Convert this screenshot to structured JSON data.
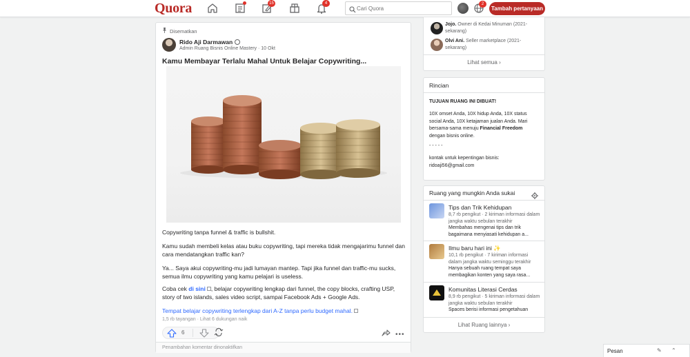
{
  "header": {
    "logo": "Quora",
    "notifications_badges": {
      "answer": "15",
      "notifications": "4",
      "language": "2"
    },
    "search_placeholder": "Cari Quora",
    "add_question": "Tambah pertanyaan"
  },
  "post": {
    "pinned_label": "Disematkan",
    "author": "Rido Aji Darmawan",
    "author_meta": "Admin Ruang Bisnis Online Mastery · 10 Okt",
    "title": "Kamu Membayar Terlalu Mahal Untuk Belajar Copywriting...",
    "p1": "Copywriting tanpa funnel & traffic is bullshit.",
    "p2": "Kamu sudah membeli kelas atau buku copywriting, tapi mereka tidak mengajarimu funnel dan cara mendatangkan traffic kan?",
    "p3": "Ya... Saya akui copywriting-mu jadi lumayan mantep. Tapi jika funnel dan traffic-mu sucks, semua ilmu copywriting yang kamu pelajari is useless.",
    "p4_pre": "Coba cek ",
    "p4_link": "di sini",
    "p4_post": ", belajar copywriting lengkap dari funnel, the copy blocks, crafting USP, story of two islands, sales video script, sampai Facebook Ads + Google Ads.",
    "link_text": "Tempat belajar copywriting terlengkap dari A-Z tanpa perlu budget mahal.",
    "stats": "1,5 rb tayangan · Lihat 6 dukungan naik",
    "upvotes": "6",
    "comments_disabled": "Penambahan komentar dinonaktifkan"
  },
  "members": {
    "items": [
      {
        "name": "Jojo.",
        "desc": " Owner di Kedai Minuman (2021-sekarang)"
      },
      {
        "name": "Olvi Ani.",
        "desc": " Seller marketplace (2021-sekarang)"
      }
    ],
    "see_all": "Lihat semua"
  },
  "details": {
    "heading": "Rincian",
    "purpose": "TUJUAN RUANG INI DIBUAT!",
    "body_pre": "10X omset Anda, 10X hidup Anda, 10X status social Anda, 10X ketajaman jualan Anda. Mari bersama-sama menuju ",
    "body_bold": "Financial Freedom",
    "body_post": " dengan bisnis online.",
    "dashes": "- - - - -",
    "contact": "kontak untuk kepentingan bisnis: ridoaji56@gmail.com"
  },
  "spaces": {
    "heading": "Ruang yang mungkin Anda sukai",
    "items": [
      {
        "title": "Tips dan Trik Kehidupan",
        "sub": "8,7 rb pengikut · 2 kiriman informasi dalam jangka waktu sebulan terakhir",
        "desc": "Membahas mengenai tips dan trik bagaimana menyiasati kehidupan a...",
        "color": "#8fb1e8"
      },
      {
        "title": "Ilmu baru hari ini ✨",
        "sub": "10,1 rb pengikut · 7 kiriman informasi dalam jangka waktu seminggu terakhir",
        "desc": "Hanya sebuah ruang tempat saya membagikan konten yang saya rasa...",
        "color": "#c9a46a"
      },
      {
        "title": "Komunitas Literasi Cerdas",
        "sub": "8,9 rb pengikut · 5 kiriman informasi dalam jangka waktu sebulan terakhir",
        "desc": "Spaces berisi informasi pengetahuan",
        "color": "#1a1a1a"
      }
    ],
    "more": "Lihat Ruang lainnya"
  },
  "messages": {
    "label": "Pesan"
  }
}
